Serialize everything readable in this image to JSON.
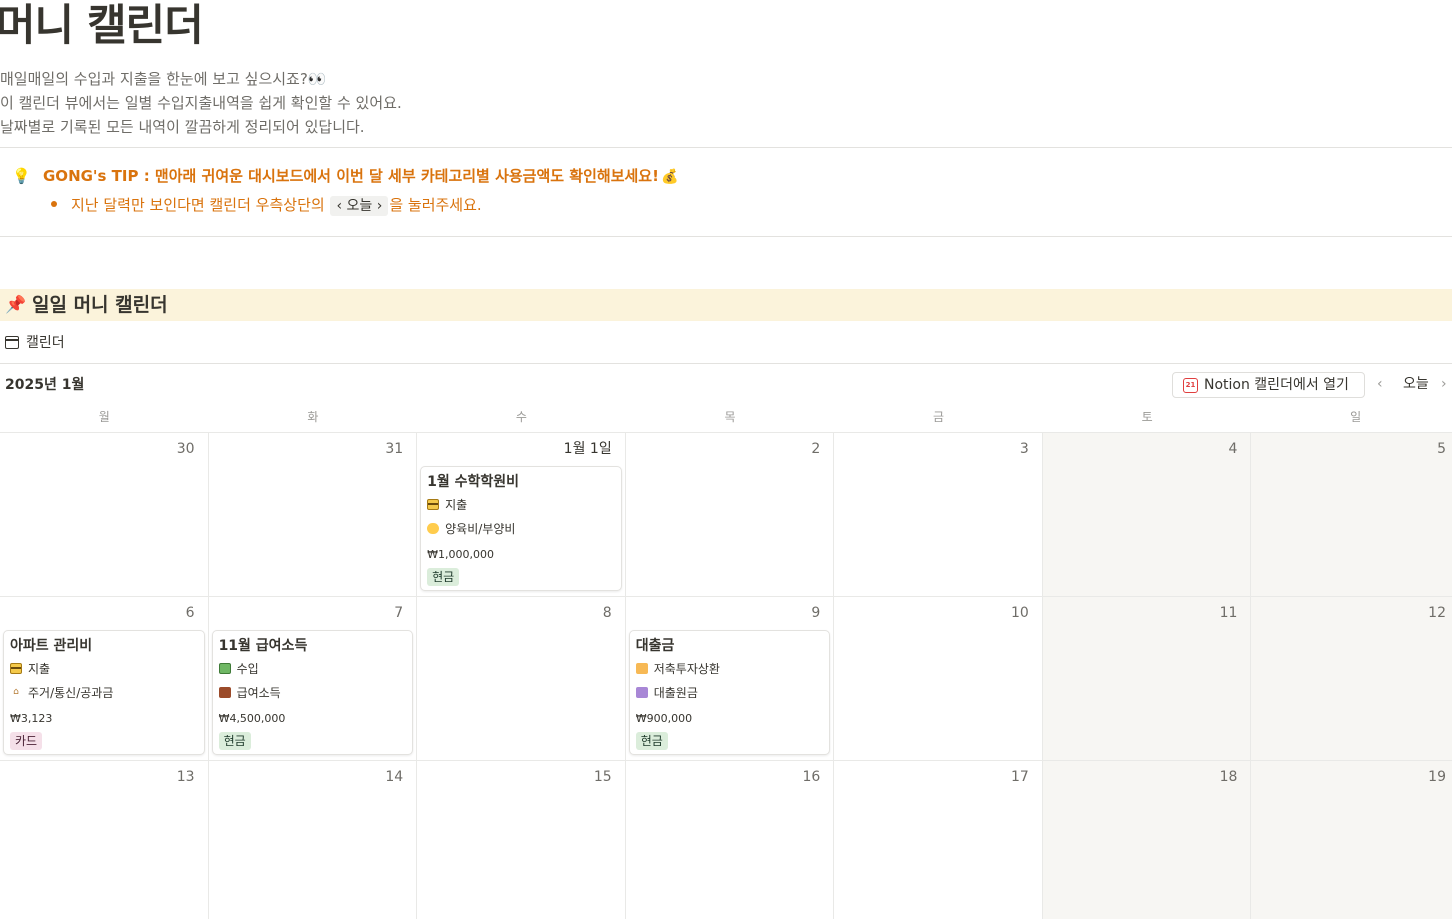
{
  "page": {
    "title": "머니 캘린더",
    "intro": [
      "매일매일의 수입과 지출을 한눈에 보고 싶으시죠?👀",
      "이 캘린더 뷰에서는 일별 수입지출내역을 쉽게 확인할 수 있어요.",
      "날짜별로 기록된 모든 내역이 깔끔하게 정리되어 있답니다."
    ]
  },
  "tip": {
    "icon": "lightbulb-icon",
    "title": "GONG's TIP : 맨아래 귀여운 대시보드에서 이번 달 세부 카테고리별 사용금액도 확인해보세요!",
    "title_emoji": "💰",
    "sub_before": "지난 달력만 보인다면 캘린더 우측상단의",
    "sub_button": "‹ 오늘 ›",
    "sub_after": "을 눌러주세요.",
    "color": "#d9730d"
  },
  "section": {
    "title": "일일 머니 캘린더",
    "background": "#fbf3db"
  },
  "view": {
    "tab_label": "캘린더",
    "month_label": "2025년 1월",
    "open_button": "Notion 캘린더에서 열기",
    "open_icon_text": "21",
    "today_button": "오늘",
    "prev": "‹",
    "next": "›"
  },
  "weekdays": [
    "월",
    "화",
    "수",
    "목",
    "금",
    "토",
    "일"
  ],
  "weeks": [
    [
      {
        "num": "30"
      },
      {
        "num": "31"
      },
      {
        "num": "1월 1일",
        "first": true,
        "event": {
          "title": "1월 수학학원비",
          "type_icon": "credit-card-icon",
          "type": "지출",
          "cat_icon": "baby-icon",
          "category": "양육비/부양비",
          "amount": "₩1,000,000",
          "tag": "현금",
          "tag_bg": "#dbeddb",
          "tag_fg": "#1c3829"
        }
      },
      {
        "num": "2"
      },
      {
        "num": "3"
      },
      {
        "num": "4",
        "weekend": true
      },
      {
        "num": "5",
        "weekend": true
      }
    ],
    [
      {
        "num": "6",
        "event": {
          "title": "아파트 관리비",
          "type_icon": "credit-card-icon",
          "type": "지출",
          "cat_icon": "house-icon",
          "category": "주거/통신/공과금",
          "amount": "₩3,123",
          "tag": "카드",
          "tag_bg": "#f5e0e9",
          "tag_fg": "#4c2337"
        }
      },
      {
        "num": "7",
        "event": {
          "title": "11월 급여소득",
          "type_icon": "cash-icon",
          "type": "수입",
          "cat_icon": "briefcase-icon",
          "category": "급여소득",
          "amount": "₩4,500,000",
          "tag": "현금",
          "tag_bg": "#dbeddb",
          "tag_fg": "#1c3829"
        }
      },
      {
        "num": "8"
      },
      {
        "num": "9",
        "event": {
          "title": "대출금",
          "type_icon": "savings-icon",
          "type": "저축투자상환",
          "cat_icon": "loan-icon",
          "category": "대출원금",
          "amount": "₩900,000",
          "tag": "현금",
          "tag_bg": "#dbeddb",
          "tag_fg": "#1c3829"
        }
      },
      {
        "num": "10"
      },
      {
        "num": "11",
        "weekend": true
      },
      {
        "num": "12",
        "weekend": true
      }
    ],
    [
      {
        "num": "13"
      },
      {
        "num": "14"
      },
      {
        "num": "15"
      },
      {
        "num": "16"
      },
      {
        "num": "17"
      },
      {
        "num": "18",
        "weekend": true
      },
      {
        "num": "19",
        "weekend": true
      }
    ]
  ]
}
